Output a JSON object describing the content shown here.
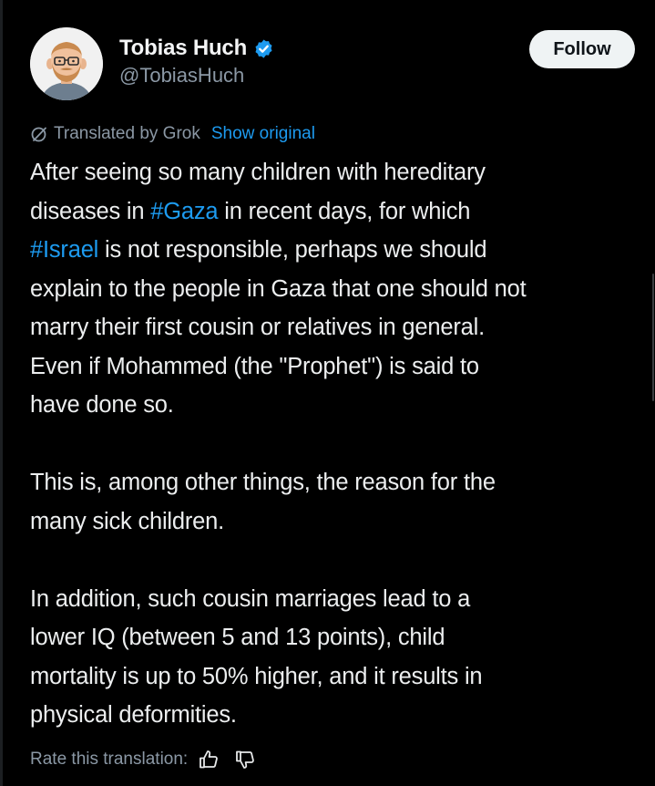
{
  "author": {
    "display_name": "Tobias Huch",
    "handle": "@TobiasHuch",
    "verified": true,
    "avatar_icon": "cartoon-avatar-bald-bearded-glasses"
  },
  "actions": {
    "follow_label": "Follow"
  },
  "translation": {
    "label": "Translated by Grok",
    "show_original_label": "Show original",
    "rate_label": "Rate this translation:",
    "thumbs_up_icon": "thumbs-up-icon",
    "thumbs_down_icon": "thumbs-down-icon"
  },
  "tweet": {
    "paragraphs": [
      {
        "lines": [
          [
            {
              "text": "After seeing so many children with hereditary"
            }
          ],
          [
            {
              "text": "diseases in "
            },
            {
              "text": "#Gaza",
              "hashtag": true
            },
            {
              "text": " in recent days, for which"
            }
          ],
          [
            {
              "text": "#Israel",
              "hashtag": true
            },
            {
              "text": " is not responsible, perhaps we should"
            }
          ],
          [
            {
              "text": "explain to the people in Gaza that one should not"
            }
          ],
          [
            {
              "text": "marry their first cousin or relatives in general."
            }
          ],
          [
            {
              "text": "Even if Mohammed (the \"Prophet\") is said to"
            }
          ],
          [
            {
              "text": "have done so."
            }
          ]
        ]
      },
      {
        "lines": [
          [
            {
              "text": "This is, among other things, the reason for the"
            }
          ],
          [
            {
              "text": "many sick children."
            }
          ]
        ]
      },
      {
        "lines": [
          [
            {
              "text": "In addition, such cousin marriages lead to a"
            }
          ],
          [
            {
              "text": "lower IQ (between 5 and 13 points), child"
            }
          ],
          [
            {
              "text": "mortality is up to 50% higher, and it results in"
            }
          ],
          [
            {
              "text": "physical deformities."
            }
          ]
        ]
      }
    ]
  },
  "colors": {
    "background": "#000000",
    "text": "#e7e9ea",
    "secondary_text": "#8b98a5",
    "link": "#1d9bf0",
    "verified_badge": "#1d9bf0",
    "follow_button_bg": "#eff3f4",
    "follow_button_text": "#0f1419"
  }
}
